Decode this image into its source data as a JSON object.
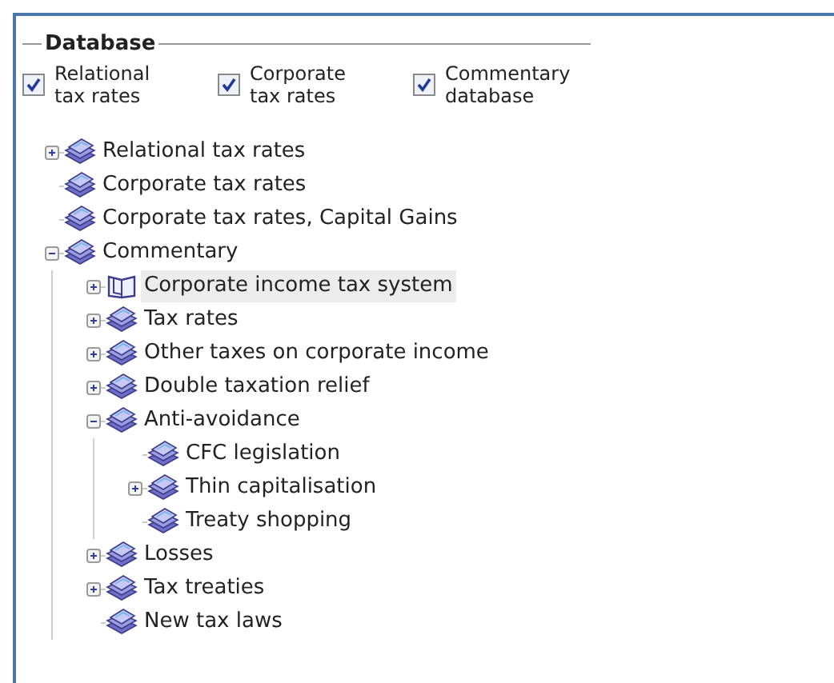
{
  "group": {
    "title": "Database"
  },
  "checkboxes": [
    {
      "label": "Relational tax rates",
      "checked": true
    },
    {
      "label": "Corporate tax rates",
      "checked": true
    },
    {
      "label": "Commentary database",
      "checked": true
    }
  ],
  "tree": [
    {
      "label": "Relational tax rates",
      "kind": "book",
      "expanded": false,
      "selected": false
    },
    {
      "label": "Corporate tax rates",
      "kind": "book",
      "selected": false
    },
    {
      "label": "Corporate tax rates, Capital Gains",
      "kind": "book",
      "selected": false
    },
    {
      "label": "Commentary",
      "kind": "book",
      "expanded": true,
      "selected": false,
      "children": [
        {
          "label": "Corporate income tax system",
          "kind": "open-book",
          "expanded": false,
          "selected": true
        },
        {
          "label": "Tax rates",
          "kind": "book",
          "expanded": false,
          "selected": false
        },
        {
          "label": "Other taxes on corporate income",
          "kind": "book",
          "expanded": false,
          "selected": false
        },
        {
          "label": "Double taxation relief",
          "kind": "book",
          "expanded": false,
          "selected": false
        },
        {
          "label": "Anti-avoidance",
          "kind": "book",
          "expanded": true,
          "selected": false,
          "children": [
            {
              "label": "CFC legislation",
              "kind": "book",
              "selected": false
            },
            {
              "label": "Thin capitalisation",
              "kind": "book",
              "expanded": false,
              "selected": false
            },
            {
              "label": "Treaty shopping",
              "kind": "book",
              "selected": false
            }
          ]
        },
        {
          "label": "Losses",
          "kind": "book",
          "expanded": false,
          "selected": false
        },
        {
          "label": "Tax treaties",
          "kind": "book",
          "expanded": false,
          "selected": false
        },
        {
          "label": "New tax laws",
          "kind": "book",
          "selected": false
        }
      ]
    }
  ]
}
